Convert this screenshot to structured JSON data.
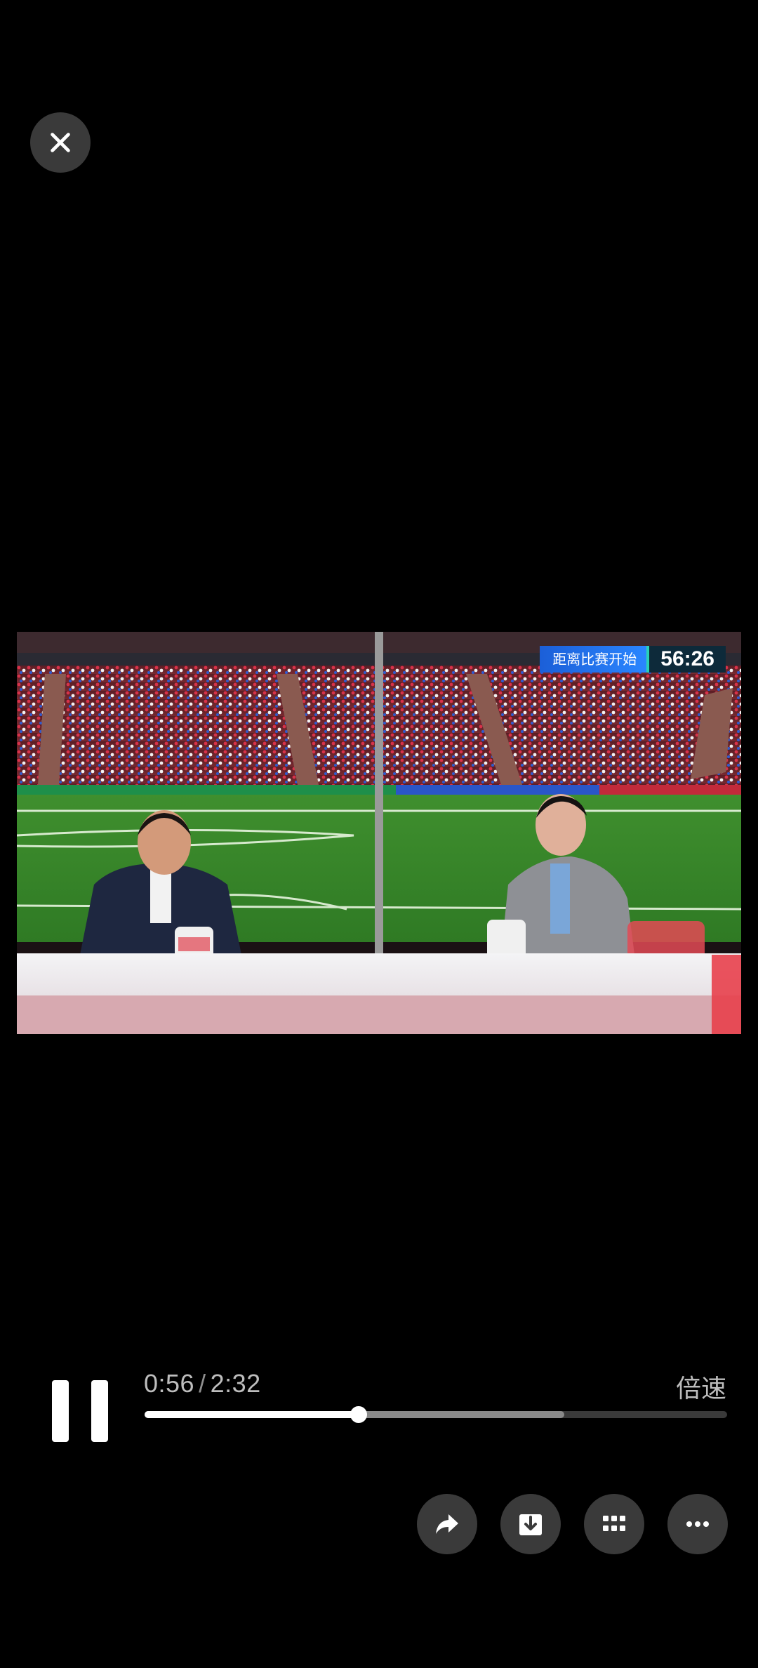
{
  "player": {
    "current_time": "0:56",
    "separator": "/",
    "duration": "2:32",
    "speed_label": "倍速",
    "progress_fraction": 0.368,
    "buffered_fraction": 0.72
  },
  "video": {
    "overlay_label": "距离比赛开始",
    "overlay_time": "56:26"
  },
  "icons": {
    "close": "close-icon",
    "pause": "pause-icon",
    "share": "share-icon",
    "download": "download-icon",
    "grid": "grid-icon",
    "more": "more-icon"
  }
}
